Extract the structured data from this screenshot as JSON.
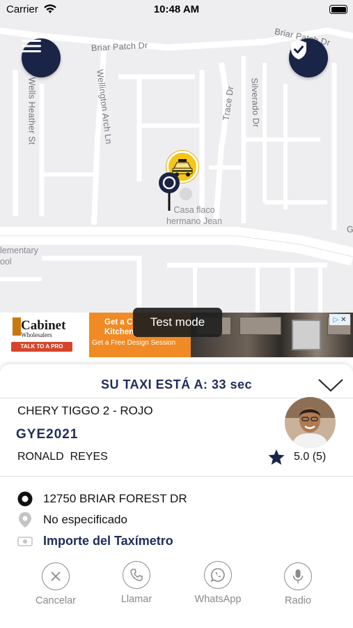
{
  "status_bar": {
    "carrier": "Carrier",
    "time": "10:48 AM"
  },
  "map": {
    "streets": {
      "briar_patch_dr": "Briar Patch Dr",
      "briar_patch_dr_ne": "Briar Patch Dr",
      "wellington_arch_ln": "Wellington Arch Ln",
      "wells_heather_st": "Wells Heather St",
      "trace_dr": "Trace Dr",
      "silverado_dr": "Silverado Dr",
      "edge_g": "G"
    },
    "poi": {
      "place_line1": "Casa flaco",
      "place_line2": "hermano Jean",
      "school_line1": "lementary",
      "school_line2": "ool"
    }
  },
  "ad": {
    "brand": "Cabinet",
    "brand_sub": "Wholesalers",
    "cta": "TALK TO A PRO",
    "headline_1": "Get a C",
    "headline_2": "Kitchen",
    "tagline": "Get a Free Design Session",
    "toast": "Test mode"
  },
  "trip": {
    "eta_label": "SU TAXI ESTÁ A: 33 sec",
    "car_model": "CHERY TIGGO 2 - ROJO",
    "plate": "GYE2021",
    "driver_name": "RONALD  REYES",
    "rating": "5.0 (5)",
    "pickup": "12750 BRIAR FOREST DR",
    "destination": "No especificado",
    "fare": "Importe del Taxímetro"
  },
  "actions": {
    "cancel": "Cancelar",
    "call": "Llamar",
    "whatsapp": "WhatsApp",
    "radio": "Radio"
  },
  "colors": {
    "primary": "#1f2c5c",
    "button_dark": "#1a2447",
    "taxi_yellow": "#f5c518",
    "map_bg": "#eeeef0"
  },
  "icons": [
    "menu-icon",
    "shield-check-icon",
    "taxi-icon",
    "pin-icon",
    "chevron-down-icon",
    "star-icon",
    "origin-dot-icon",
    "destination-pin-icon",
    "cash-icon",
    "close-icon",
    "phone-icon",
    "whatsapp-icon",
    "microphone-icon"
  ]
}
